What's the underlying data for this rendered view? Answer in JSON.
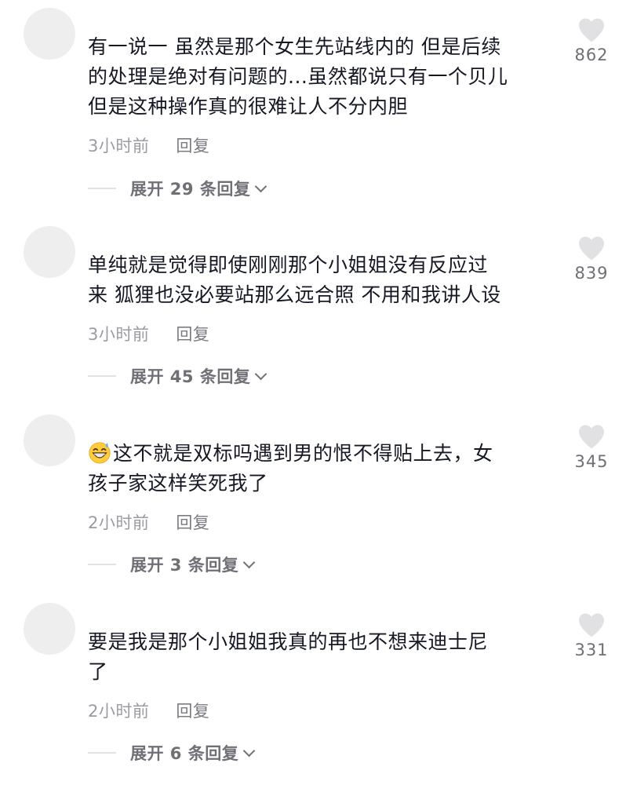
{
  "comments": [
    {
      "text_lines": [
        "有一说一 虽然是那个女生先站线内的 但是后续",
        "的处理是绝对有问题的...虽然都说只有一个贝儿",
        "但是这种操作真的很难让人不分内胆"
      ],
      "time": "3小时前",
      "reply_label": "回复",
      "expand_label": "展开 29 条回复",
      "likes": "862"
    },
    {
      "text_lines": [
        "单纯就是觉得即使刚刚那个小姐姐没有反应过",
        "来 狐狸也没必要站那么远合照 不用和我讲人设"
      ],
      "time": "3小时前",
      "reply_label": "回复",
      "expand_label": "展开 45 条回复",
      "likes": "839"
    },
    {
      "emoji": "grinning-sweat-emoji",
      "text_lines": [
        "这不就是双标吗遇到男的恨不得贴上去，女",
        "孩子家这样笑死我了"
      ],
      "time": "2小时前",
      "reply_label": "回复",
      "expand_label": "展开 3 条回复",
      "likes": "345"
    },
    {
      "text_lines": [
        "要是我是那个小姐姐我真的再也不想来迪士尼",
        "了"
      ],
      "time": "2小时前",
      "reply_label": "回复",
      "expand_label": "展开 6 条回复",
      "likes": "331"
    }
  ],
  "icons": {
    "like": "heart-icon",
    "expand": "chevron-down-icon"
  },
  "colors": {
    "text": "#161823",
    "meta": "#9b9ba1",
    "heart": "#e1e1e3",
    "avatar": "#eeeeee"
  }
}
